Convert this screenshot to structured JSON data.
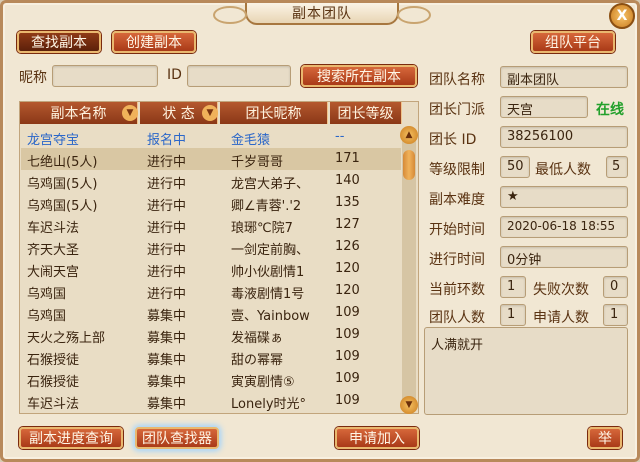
{
  "window": {
    "title": "副本团队",
    "close_label": "X"
  },
  "tabs": {
    "find": "查找副本",
    "create": "创建副本",
    "platform": "组队平台"
  },
  "search": {
    "nickname_label": "昵称",
    "nickname_value": "",
    "id_label": "ID",
    "id_value": "",
    "search_button": "搜索所在副本"
  },
  "table": {
    "headers": [
      "副本名称",
      "状 态",
      "团长昵称",
      "团长等级"
    ],
    "rows": [
      [
        "龙宫夺宝",
        "报名中",
        "金毛猿",
        "--"
      ],
      [
        "七绝山(5人)",
        "进行中",
        "千岁哥哥",
        "171"
      ],
      [
        "乌鸡国(5人)",
        "进行中",
        "龙宫大弟子、",
        "140"
      ],
      [
        "乌鸡国(5人)",
        "进行中",
        "卿∠青蓉'.'2",
        "135"
      ],
      [
        "车迟斗法",
        "进行中",
        "琅琊℃院7",
        "127"
      ],
      [
        "齐天大圣",
        "进行中",
        "一剑定前胸、",
        "126"
      ],
      [
        "大闹天宫",
        "进行中",
        "帅小伙剧情1",
        "120"
      ],
      [
        "乌鸡国",
        "进行中",
        "毒液剧情1号",
        "120"
      ],
      [
        "乌鸡国",
        "募集中",
        "壹、Yainbow",
        "109"
      ],
      [
        "天火之殇上部",
        "募集中",
        "发福碟ぁ",
        "109"
      ],
      [
        "石猴授徒",
        "募集中",
        "甜の幂幂",
        "109"
      ],
      [
        "石猴授徒",
        "募集中",
        "寅寅剧情⑤",
        "109"
      ],
      [
        "车迟斗法",
        "募集中",
        "Lonely时光°",
        "109"
      ]
    ]
  },
  "team": {
    "name_label": "团队名称",
    "name_value": "副本团队",
    "sect_label": "团长门派",
    "sect_value": "天宫",
    "online": "在线",
    "leader_id_label": "团长 ID",
    "leader_id_value": "38256100",
    "level_limit_label": "等级限制",
    "level_limit_value": "50",
    "min_people_label": "最低人数",
    "min_people_value": "5",
    "difficulty_label": "副本难度",
    "difficulty_value": "★",
    "start_label": "开始时间",
    "start_value": "2020-06-18 18:55",
    "elapsed_label": "进行时间",
    "elapsed_value": "0分钟",
    "round_label": "当前环数",
    "round_value": "1",
    "fail_label": "失败次数",
    "fail_value": "0",
    "members_label": "团队人数",
    "members_value": "1",
    "apply_label": "申请人数",
    "apply_value": "1",
    "notice": "人满就开"
  },
  "footer": {
    "progress": "副本进度查询",
    "finder": "团队查找器",
    "apply": "申请加入",
    "report": "举"
  },
  "colors": {
    "accent": "#a93a18",
    "online": "#22a02b",
    "highlight": "#2b67c9"
  }
}
